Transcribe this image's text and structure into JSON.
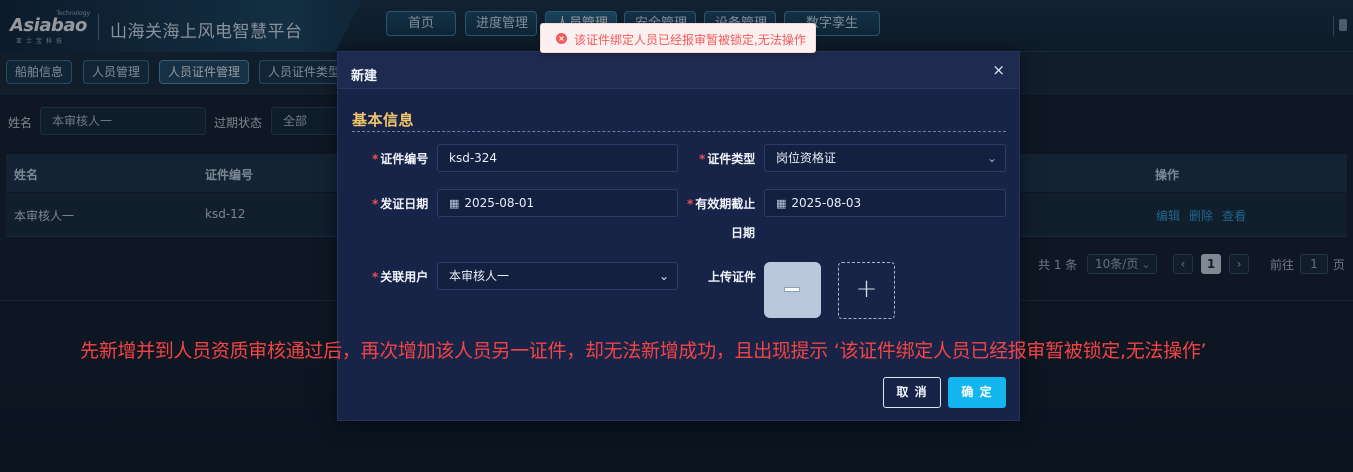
{
  "header": {
    "logo_word": "Asiabao",
    "logo_tag": "Technology",
    "logo_sub": "亚士宝科技",
    "platform_title": "山海关海上风电智慧平台",
    "nav_tabs": [
      {
        "label": "首页"
      },
      {
        "label": "进度管理"
      },
      {
        "label": "人员管理"
      },
      {
        "label": "安全管理"
      },
      {
        "label": "设备管理"
      },
      {
        "label": "数字孪生"
      }
    ]
  },
  "subtabs": [
    {
      "label": "船舶信息"
    },
    {
      "label": "人员管理"
    },
    {
      "label": "人员证件管理"
    },
    {
      "label": "人员证件类型"
    }
  ],
  "filters": {
    "name_label": "姓名",
    "name_value": "本审核人一",
    "expire_label": "过期状态",
    "expire_value": "全部"
  },
  "table": {
    "columns": [
      "姓名",
      "证件编号",
      "操作"
    ],
    "rows": [
      {
        "name": "本审核人一",
        "cert_no": "ksd-12",
        "actions": [
          "编辑",
          "删除",
          "查看"
        ]
      }
    ]
  },
  "pagination": {
    "total": "共 1 条",
    "page_size": "10条/页",
    "prev": "‹",
    "current": "1",
    "next": "›",
    "goto_label": "前往",
    "goto_value": "1",
    "page_unit": "页"
  },
  "toast": {
    "icon": "error-icon",
    "message": "该证件绑定人员已经报审暂被锁定,无法操作",
    "color": "#f25b5b"
  },
  "modal": {
    "title": "新建",
    "close": "×",
    "section_title": "基本信息",
    "fields": {
      "cert_no_label": "证件编号",
      "cert_no_value": "ksd-324",
      "cert_type_label": "证件类型",
      "cert_type_value": "岗位资格证",
      "issue_date_label": "发证日期",
      "issue_date_value": "2025-08-01",
      "expire_date_label_1": "有效期截止",
      "expire_date_label_2": "日期",
      "expire_date_value": "2025-08-03",
      "user_label": "关联用户",
      "user_value": "本审核人一",
      "upload_label": "上传证件"
    },
    "cancel_label": "取 消",
    "confirm_label": "确 定",
    "accent": "#13b6ee"
  },
  "annotation": {
    "text": "先新增并到人员资质审核通过后，再次增加该人员另一证件，却无法新增成功，且出现提示 ‘该证件绑定人员已经报审暂被锁定,无法操作’",
    "color": "#f24444"
  }
}
